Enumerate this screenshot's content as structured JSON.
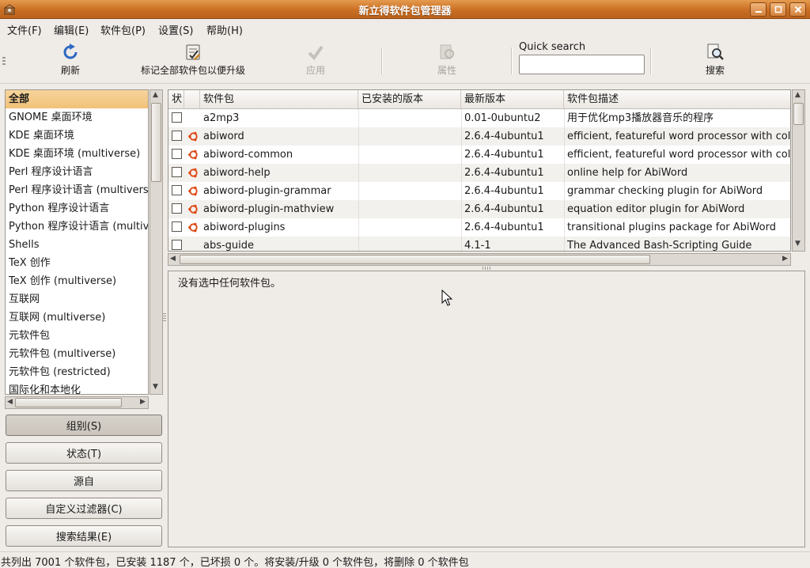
{
  "window": {
    "title": "新立得软件包管理器"
  },
  "menu": [
    {
      "label": "文件(F)"
    },
    {
      "label": "编辑(E)"
    },
    {
      "label": "软件包(P)"
    },
    {
      "label": "设置(S)"
    },
    {
      "label": "帮助(H)"
    }
  ],
  "toolbar": {
    "refresh": {
      "label": "刷新",
      "icon": "refresh-icon"
    },
    "mark_all": {
      "label": "标记全部软件包以便升级",
      "icon": "mark-upgrade-icon"
    },
    "apply": {
      "label": "应用",
      "icon": "apply-check-icon",
      "enabled": false
    },
    "properties": {
      "label": "属性",
      "icon": "properties-icon",
      "enabled": false
    },
    "quick_search": {
      "label": "Quick search",
      "value": ""
    },
    "search": {
      "label": "搜索",
      "icon": "search-icon"
    }
  },
  "sections": {
    "selected_index": 0,
    "items": [
      "全部",
      "GNOME 桌面环境",
      "KDE 桌面环境",
      "KDE 桌面环境 (multiverse)",
      "Perl 程序设计语言",
      "Perl 程序设计语言 (multiverse)",
      "Python 程序设计语言",
      "Python 程序设计语言 (multiverse)",
      "Shells",
      "TeX 创作",
      "TeX 创作 (multiverse)",
      "互联网",
      "互联网 (multiverse)",
      "元软件包",
      "元软件包 (multiverse)",
      "元软件包 (restricted)",
      "国际化和本地化"
    ]
  },
  "filter_buttons": {
    "groups": "组别(S)",
    "status": "状态(T)",
    "origin": "源自",
    "custom": "自定义过滤器(C)",
    "search_results": "搜索结果(E)"
  },
  "table": {
    "columns": {
      "status": "状",
      "package": "软件包",
      "installed": "已安装的版本",
      "latest": "最新版本",
      "description": "软件包描述"
    },
    "rows": [
      {
        "package": "a2mp3",
        "installed": "",
        "latest": "0.01-0ubuntu2",
        "description": "用于优化mp3播放器音乐的程序",
        "supported": false
      },
      {
        "package": "abiword",
        "installed": "",
        "latest": "2.6.4-4ubuntu1",
        "description": "efficient, featureful word processor with colla",
        "supported": true
      },
      {
        "package": "abiword-common",
        "installed": "",
        "latest": "2.6.4-4ubuntu1",
        "description": "efficient, featureful word processor with colla",
        "supported": true
      },
      {
        "package": "abiword-help",
        "installed": "",
        "latest": "2.6.4-4ubuntu1",
        "description": "online help for AbiWord",
        "supported": true
      },
      {
        "package": "abiword-plugin-grammar",
        "installed": "",
        "latest": "2.6.4-4ubuntu1",
        "description": "grammar checking plugin for AbiWord",
        "supported": true
      },
      {
        "package": "abiword-plugin-mathview",
        "installed": "",
        "latest": "2.6.4-4ubuntu1",
        "description": "equation editor plugin for AbiWord",
        "supported": true
      },
      {
        "package": "abiword-plugins",
        "installed": "",
        "latest": "2.6.4-4ubuntu1",
        "description": "transitional plugins package for AbiWord",
        "supported": true
      },
      {
        "package": "abs-guide",
        "installed": "",
        "latest": "4.1-1",
        "description": "The Advanced Bash-Scripting Guide",
        "supported": false
      }
    ]
  },
  "details": {
    "message": "没有选中任何软件包。"
  },
  "status_bar": {
    "text": "共列出 7001 个软件包，已安装 1187 个，已坏损 0 个。将安装/升级 0 个软件包，将删除 0 个软件包"
  }
}
